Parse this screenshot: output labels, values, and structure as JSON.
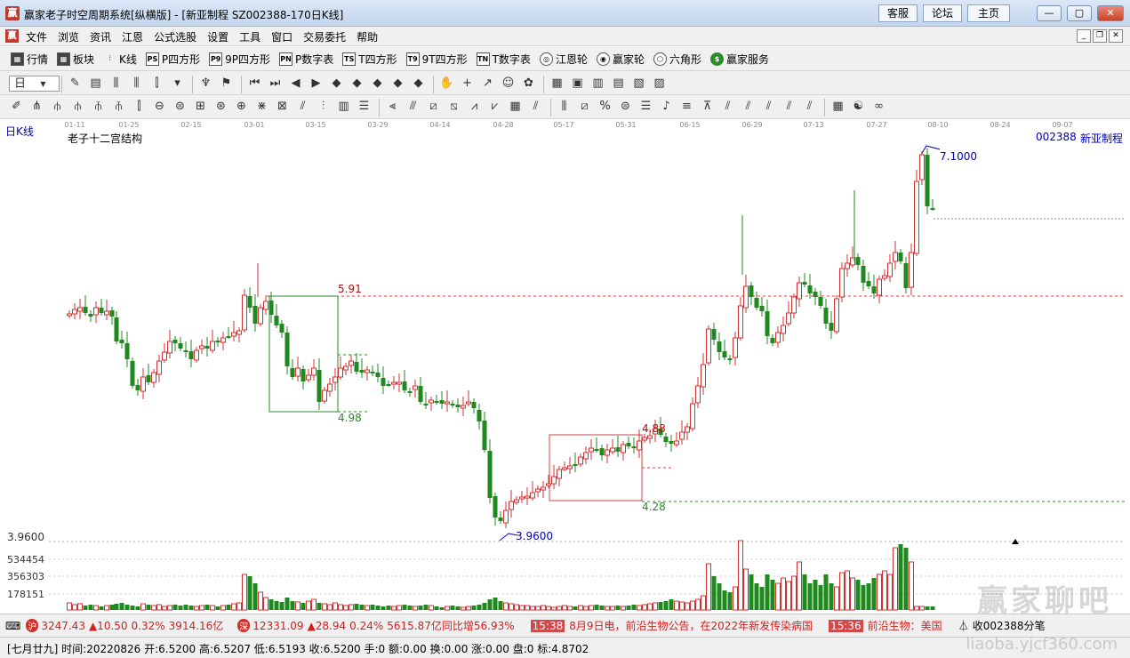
{
  "window": {
    "title": "赢家老子时空周期系统[纵横版] - [新亚制程   SZ002388-170日K线]",
    "links": [
      "客服",
      "论坛",
      "主页"
    ]
  },
  "menu": [
    "文件",
    "浏览",
    "资讯",
    "江恩",
    "公式选股",
    "设置",
    "工具",
    "窗口",
    "交易委托",
    "帮助"
  ],
  "toolbar1": [
    {
      "icon": "grid-icon",
      "label": "行情"
    },
    {
      "icon": "blocks-icon",
      "label": "板块"
    },
    {
      "icon": "kline-icon",
      "label": "K线"
    },
    {
      "icon": "ps-icon",
      "glyph": "PS",
      "label": "P四方形"
    },
    {
      "icon": "p9-icon",
      "glyph": "P9",
      "label": "9P四方形"
    },
    {
      "icon": "pn-icon",
      "glyph": "PN",
      "label": "P数字表"
    },
    {
      "icon": "ts-icon",
      "glyph": "TS",
      "label": "T四方形"
    },
    {
      "icon": "t9-icon",
      "glyph": "T9",
      "label": "9T四方形"
    },
    {
      "icon": "tn-icon",
      "glyph": "TN",
      "label": "T数字表"
    },
    {
      "icon": "gann-wheel-icon",
      "label": "江恩轮"
    },
    {
      "icon": "winner-wheel-icon",
      "label": "赢家轮"
    },
    {
      "icon": "hexagon-icon",
      "label": "六角形"
    },
    {
      "icon": "dollar-icon",
      "label": "赢家服务"
    }
  ],
  "toolbar2": {
    "period": "日"
  },
  "chart": {
    "period_label": "日K线",
    "indicator_title": "老子十二宫结构",
    "stock_code": "002388",
    "stock_name": "新亚制程",
    "date_ticks": [
      "01-11",
      "01-25",
      "02-15",
      "03-01",
      "03-15",
      "03-29",
      "04-14",
      "04-28",
      "05-17",
      "05-31",
      "06-15",
      "06-29",
      "07-13",
      "07-27",
      "08-10",
      "08-24",
      "09-07"
    ],
    "price_labels": {
      "high": "7.1000",
      "low": "3.9600",
      "low_axis": "3.9600",
      "box1_top": "5.91",
      "box1_bottom": "4.98",
      "box2_top": "4.88",
      "box2_bottom": "4.28"
    },
    "volume_axis": [
      "534454",
      "356303",
      "178151"
    ]
  },
  "ticker": {
    "sh_badge": "沪",
    "sh_index": "3247.43",
    "sh_change": "▲10.50",
    "sh_pct": "0.32%",
    "sh_amount": "3914.16亿",
    "sz_badge": "深",
    "sz_index": "12331.09",
    "sz_change": "▲28.94",
    "sz_pct": "0.24%",
    "sz_amount": "5615.87亿",
    "news1": "同比增56.93%",
    "time1": "15:38",
    "news2": "8月9日电，前沿生物公告，在2022年新发传染病国",
    "time2": "15:36",
    "news3": "前沿生物：美国",
    "ticker_suffix": "收002388分笔"
  },
  "status": "[七月廿九] 时间:20220826 开:6.5200 高:6.5207 低:6.5193 收:6.5200 手:0 额:0.00 换:0.00 涨:0.00 盘:0 标:4.8702",
  "watermark": "赢家聊吧",
  "watermark_url": "liaoba.yjcf360.com"
}
